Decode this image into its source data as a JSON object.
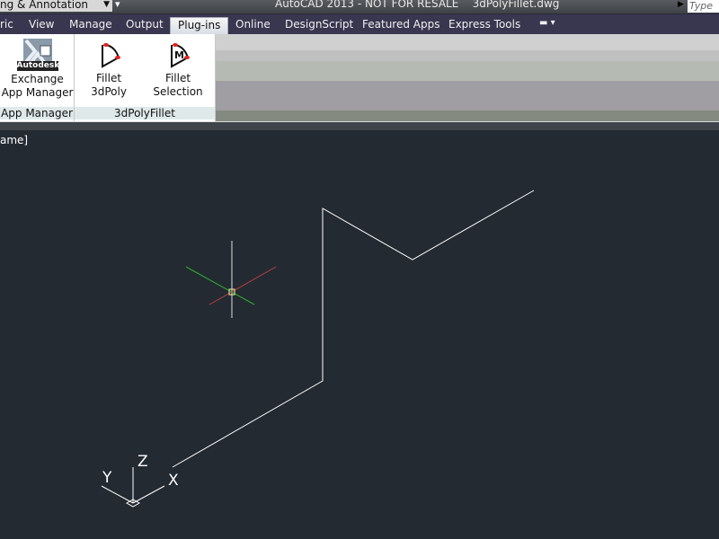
{
  "titlebar": {
    "workspace": "ng & Annotation",
    "title": "AutoCAD 2013 - NOT FOR RESALE    3dPolyFillet.dwg",
    "search_placeholder": "Type a"
  },
  "tabs": [
    {
      "label": "ric"
    },
    {
      "label": "View"
    },
    {
      "label": "Manage"
    },
    {
      "label": "Output"
    },
    {
      "label": "Plug-ins",
      "active": true
    },
    {
      "label": "Online"
    },
    {
      "label": "DesignScript"
    },
    {
      "label": "Featured Apps"
    },
    {
      "label": "Express Tools"
    }
  ],
  "ribbon": {
    "panels": [
      {
        "label": "App Manager",
        "buttons": [
          {
            "label_line1": "Exchange",
            "label_line2": "App Manager",
            "icon": "autodesk-exchange-icon",
            "icon_text": "Autodesk"
          }
        ]
      },
      {
        "label": "3dPolyFillet",
        "buttons": [
          {
            "label": "Fillet 3dPoly",
            "icon": "fillet-3dpoly-icon"
          },
          {
            "label": "Fillet Selection",
            "icon": "fillet-selection-icon",
            "icon_text": "M"
          }
        ]
      }
    ]
  },
  "viewport": {
    "label": "ame]"
  },
  "ucs": {
    "x": "X",
    "y": "Y",
    "z": "Z"
  },
  "colors": {
    "canvas": "#232a32",
    "x_axis": "#c04040",
    "y_axis": "#30b030",
    "accent_marker": "#e02020"
  }
}
